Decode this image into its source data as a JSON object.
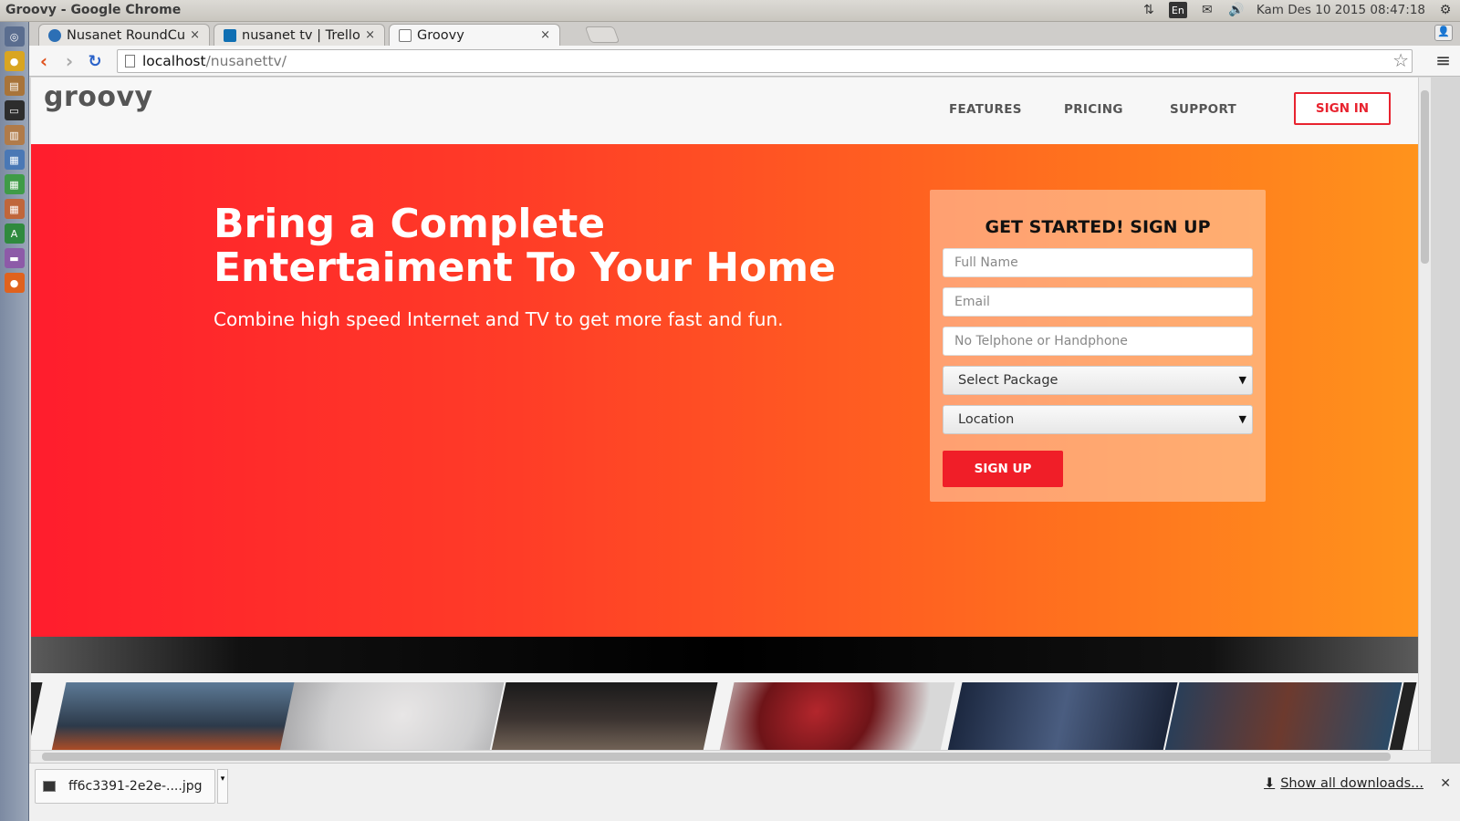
{
  "window": {
    "title": "Groovy - Google Chrome"
  },
  "tray": {
    "lang": "En",
    "datetime": "Kam Des 10 2015 08:47:18"
  },
  "tabs": [
    {
      "label": "Nusanet RoundCube",
      "close": "×"
    },
    {
      "label": "nusanet tv | Trello",
      "close": "×"
    },
    {
      "label": "Groovy",
      "close": "×"
    }
  ],
  "omnibox": {
    "host": "localhost",
    "path": "/nusanettv/"
  },
  "site": {
    "logo": "groovy",
    "nav": {
      "features": "FEATURES",
      "pricing": "PRICING",
      "support": "SUPPORT",
      "signin": "SIGN IN"
    },
    "hero": {
      "title": "Bring a Complete Entertaiment To Your Home",
      "subtitle": "Combine high speed Internet and TV to get more fast and fun."
    },
    "signup": {
      "heading": "GET STARTED! SIGN UP",
      "fullname_placeholder": "Full Name",
      "email_placeholder": "Email",
      "phone_placeholder": "No Telphone or Handphone",
      "package_selected": "Select Package",
      "location_selected": "Location",
      "button": "SIGN UP"
    }
  },
  "downloads": {
    "file": "ff6c3391-2e2e-....jpg",
    "show_all": "Show all downloads..."
  },
  "colors": {
    "accent": "#e8232f",
    "hero_start": "#ff1d2d",
    "hero_end": "#ff931c"
  }
}
